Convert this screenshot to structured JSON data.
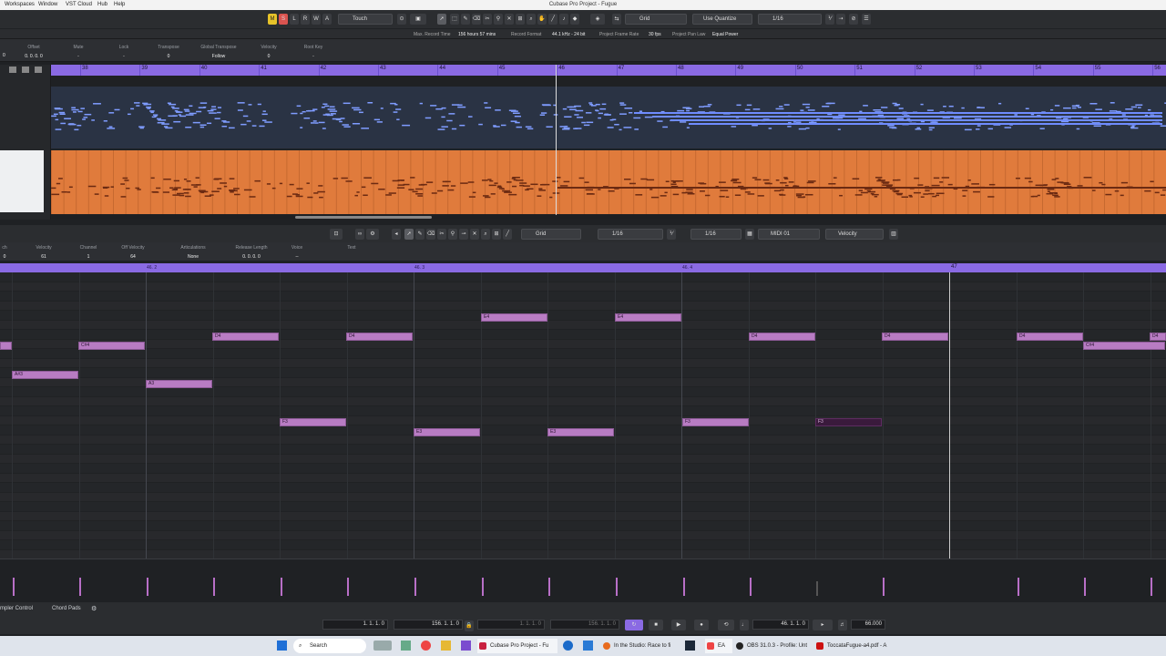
{
  "menu": [
    "Workspaces",
    "Window",
    "VST Cloud",
    "Hub",
    "Help"
  ],
  "window_title": "Cubase Pro Project - Fugue",
  "toolbar": {
    "mode_buttons": [
      "M",
      "S",
      "L",
      "R",
      "W",
      "A"
    ],
    "automation_mode": "Touch",
    "grid": "Grid",
    "quantize_mode": "Use Quantize",
    "quantize_value": "1/16"
  },
  "info": {
    "max_record_label": "Max. Record Time",
    "max_record_value": "156 hours 57 mins",
    "record_format_label": "Record Format",
    "record_format_value": "44.1 kHz - 24 bit",
    "frame_rate_label": "Project Frame Rate",
    "frame_rate_value": "30 fps",
    "pan_law_label": "Project Pan Law",
    "pan_law_value": "Equal Power"
  },
  "inspector": [
    {
      "label": "Offset",
      "value": "0. 0. 0. 0"
    },
    {
      "label": "Mute",
      "value": "-"
    },
    {
      "label": "Lock",
      "value": "-"
    },
    {
      "label": "Transpose",
      "value": "0"
    },
    {
      "label": "Global Transpose",
      "value": "Follow"
    },
    {
      "label": "Velocity",
      "value": "0"
    },
    {
      "label": "Root Key",
      "value": "-"
    }
  ],
  "inspector_left_value": "0",
  "bars": [
    "38",
    "39",
    "40",
    "41",
    "42",
    "43",
    "44",
    "45",
    "46",
    "47",
    "48",
    "49",
    "50",
    "51",
    "52",
    "53",
    "54",
    "55",
    "56"
  ],
  "lower_toolbar": {
    "grid": "Grid",
    "quantize": "1/16",
    "length": "1/16",
    "midi_channel": "MIDI 01",
    "controller": "Velocity"
  },
  "note_info": [
    {
      "label": "ch",
      "value": "0"
    },
    {
      "label": "Velocity",
      "value": "61"
    },
    {
      "label": "Channel",
      "value": "1"
    },
    {
      "label": "Off Velocity",
      "value": "64"
    },
    {
      "label": "Articulations",
      "value": "None"
    },
    {
      "label": "Release Length",
      "value": "0. 0. 0. 0"
    },
    {
      "label": "Voice",
      "value": "--"
    },
    {
      "label": "Text",
      "value": ""
    }
  ],
  "editor_ruler": [
    "46. 2",
    "46. 3",
    "46. 4",
    "47"
  ],
  "notes": [
    {
      "name": "",
      "pitch": "C#4"
    },
    {
      "name": "C#4",
      "pitch": "C#4"
    },
    {
      "name": "A#3",
      "pitch": "A#3"
    },
    {
      "name": "A3",
      "pitch": "A3"
    },
    {
      "name": "D4",
      "pitch": "D4"
    },
    {
      "name": "F3",
      "pitch": "F3"
    },
    {
      "name": "D4",
      "pitch": "D4"
    },
    {
      "name": "E3",
      "pitch": "E3"
    },
    {
      "name": "E4",
      "pitch": "E4"
    },
    {
      "name": "E3",
      "pitch": "E3"
    },
    {
      "name": "E4",
      "pitch": "E4"
    },
    {
      "name": "F3",
      "pitch": "F3"
    },
    {
      "name": "D4",
      "pitch": "D4"
    },
    {
      "name": "F3",
      "pitch": "F3"
    },
    {
      "name": "D4",
      "pitch": "D4"
    },
    {
      "name": "D4",
      "pitch": "D4"
    },
    {
      "name": "C#4",
      "pitch": "C#4"
    },
    {
      "name": "D4",
      "pitch": "D4"
    }
  ],
  "bottom_tabs": [
    "mpler Control",
    "Chord Pads"
  ],
  "transport": {
    "left_locator": "1. 1. 1. 0",
    "right_locator": "156. 1. 1. 0",
    "punch_in": "1. 1. 1. 0",
    "punch_out": "156. 1. 1. 0",
    "position": "46. 1. 1. 0",
    "tempo": "66.000"
  },
  "taskbar": {
    "search": "Search",
    "apps": [
      "Cubase Pro Project - Fu",
      "In the Studio: Race to fi",
      "EA",
      "OBS 31.0.3 - Profile: Unt",
      "ToccataFugue-a4.pdf - A"
    ]
  },
  "colors": {
    "accent": "#8a6ae3",
    "midi_part": "#e07b3c",
    "note": "#b87cc3",
    "track_blue": "#6f8cff"
  }
}
